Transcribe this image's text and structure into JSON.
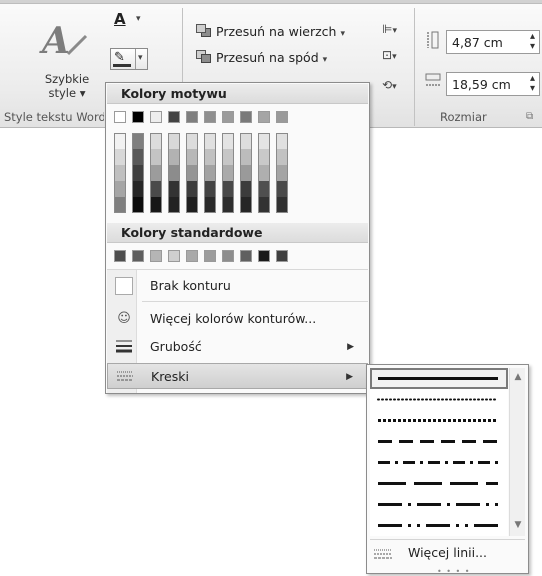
{
  "ribbon": {
    "quick_styles": {
      "label_line1": "Szybkie",
      "label_line2": "style ▾"
    },
    "text_styles_group_label": "Style tekstu WordArt",
    "arrange": {
      "bring_to_front": "Przesuń na wierzch",
      "send_to_back": "Przesuń na spód"
    },
    "size": {
      "height_value": "4,87 cm",
      "width_value": "18,59 cm",
      "group_label": "Rozmiar"
    }
  },
  "color_menu": {
    "theme_colors_header": "Kolory motywu",
    "standard_colors_header": "Kolory standardowe",
    "theme_top_row": [
      "#ffffff",
      "#000000",
      "#eeeeee",
      "#444444",
      "#7f7f7f",
      "#8f8f8f",
      "#9b9b9b",
      "#7a7a7a",
      "#a5a5a5",
      "#9a9a9a"
    ],
    "theme_columns": [
      [
        "#f2f2f2",
        "#d8d8d8",
        "#bfbfbf",
        "#a5a5a5",
        "#7f7f7f"
      ],
      [
        "#7f7f7f",
        "#595959",
        "#3f3f3f",
        "#262626",
        "#0c0c0c"
      ],
      [
        "#dddddd",
        "#c4c4c4",
        "#9c9c9c",
        "#4a4a4a",
        "#171717"
      ],
      [
        "#d9d9d9",
        "#b2b2b2",
        "#8c8c8c",
        "#333333",
        "#222222"
      ],
      [
        "#dcdcdc",
        "#b8b8b8",
        "#959595",
        "#3d3d3d",
        "#1f1f1f"
      ],
      [
        "#e0e0e0",
        "#c1c1c1",
        "#a2a2a2",
        "#434343",
        "#292929"
      ],
      [
        "#e3e3e3",
        "#c6c6c6",
        "#aaaaaa",
        "#484848",
        "#2d2d2d"
      ],
      [
        "#dddddd",
        "#bcbcbc",
        "#9a9a9a",
        "#3c3c3c",
        "#262626"
      ],
      [
        "#e4e4e4",
        "#c9c9c9",
        "#afafaf",
        "#4f4f4f",
        "#333333"
      ],
      [
        "#e0e0e0",
        "#c2c2c2",
        "#a4a4a4",
        "#4a4a4a",
        "#303030"
      ]
    ],
    "standard_colors": [
      "#4d4d4d",
      "#5e5e5e",
      "#b5b5b5",
      "#cfcfcf",
      "#a9a9a9",
      "#9c9c9c",
      "#8d8d8d",
      "#606060",
      "#1a1a1a",
      "#3f3f3f"
    ],
    "items": {
      "no_outline": "Brak konturu",
      "more_colors": "Więcej kolorów konturów...",
      "weight": "Grubość",
      "dashes": "Kreski"
    }
  },
  "dash_menu": {
    "more_lines": "Więcej linii...",
    "dash_styles": [
      "solid",
      "round-dot",
      "square-dot",
      "dash",
      "dash-dot",
      "long-dash",
      "long-dash-dot",
      "long-dash-dot-dot"
    ]
  }
}
